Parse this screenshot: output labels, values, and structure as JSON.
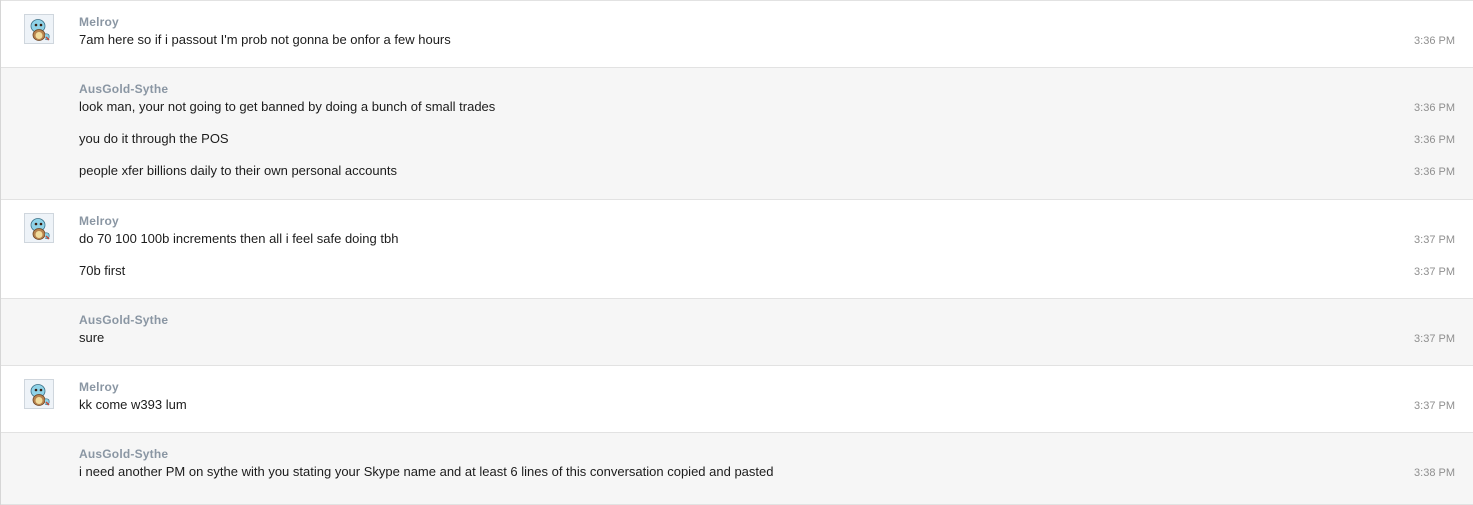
{
  "conversation": {
    "groups": [
      {
        "sender": "Melroy",
        "side": "in",
        "avatar": "squirtle-avatar",
        "messages": [
          {
            "text": "7am here so if i passout I'm prob not gonna be onfor a few hours",
            "time": "3:36 PM"
          }
        ]
      },
      {
        "sender": "AusGold-Sythe",
        "side": "out",
        "avatar": "",
        "messages": [
          {
            "text": "look man, your not going to get banned by doing a bunch of small trades",
            "time": "3:36 PM"
          },
          {
            "text": "you do it through the POS",
            "time": "3:36 PM"
          },
          {
            "text": "people xfer billions daily to their own personal accounts",
            "time": "3:36 PM"
          }
        ]
      },
      {
        "sender": "Melroy",
        "side": "in",
        "avatar": "squirtle-avatar",
        "messages": [
          {
            "text": "do 70 100 100b increments then all i feel safe doing tbh",
            "time": "3:37 PM"
          },
          {
            "text": "70b first",
            "time": "3:37 PM"
          }
        ]
      },
      {
        "sender": "AusGold-Sythe",
        "side": "out",
        "avatar": "",
        "messages": [
          {
            "text": "sure",
            "time": "3:37 PM"
          }
        ]
      },
      {
        "sender": "Melroy",
        "side": "in",
        "avatar": "squirtle-avatar",
        "messages": [
          {
            "text": "kk come w393 lum",
            "time": "3:37 PM"
          }
        ]
      },
      {
        "sender": "AusGold-Sythe",
        "side": "out",
        "avatar": "",
        "messages": [
          {
            "text": "i need another PM on sythe with you stating your Skype name and at least 6 lines of this conversation copied and pasted",
            "time": "3:38 PM"
          }
        ]
      }
    ]
  },
  "colors": {
    "incoming_bg": "#ffffff",
    "outgoing_bg": "#f6f6f6",
    "sender": "#8a96a3",
    "text": "#1c1c1c",
    "time": "#8f8f8f"
  }
}
